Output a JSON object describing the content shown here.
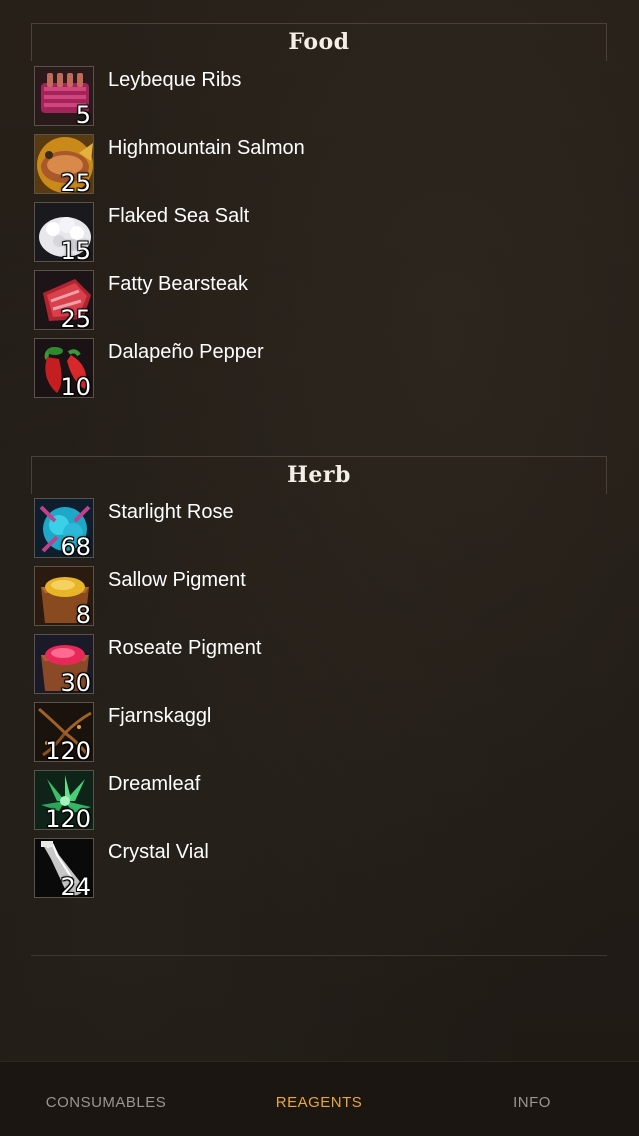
{
  "sections": [
    {
      "title": "Food",
      "items": [
        {
          "name": "Leybeque Ribs",
          "count": "5",
          "icon": "ribs-icon"
        },
        {
          "name": "Highmountain Salmon",
          "count": "25",
          "icon": "salmon-icon"
        },
        {
          "name": "Flaked Sea Salt",
          "count": "15",
          "icon": "salt-icon"
        },
        {
          "name": "Fatty Bearsteak",
          "count": "25",
          "icon": "bearsteak-icon"
        },
        {
          "name": "Dalapeño Pepper",
          "count": "10",
          "icon": "pepper-icon"
        }
      ]
    },
    {
      "title": "Herb",
      "items": [
        {
          "name": "Starlight Rose",
          "count": "68",
          "icon": "starlight-rose-icon"
        },
        {
          "name": "Sallow Pigment",
          "count": "8",
          "icon": "sallow-pigment-icon"
        },
        {
          "name": "Roseate Pigment",
          "count": "30",
          "icon": "roseate-pigment-icon"
        },
        {
          "name": "Fjarnskaggl",
          "count": "120",
          "icon": "fjarnskaggl-icon"
        },
        {
          "name": "Dreamleaf",
          "count": "120",
          "icon": "dreamleaf-icon"
        },
        {
          "name": "Crystal Vial",
          "count": "24",
          "icon": "crystal-vial-icon"
        }
      ]
    }
  ],
  "tabs": {
    "consumables": "CONSUMABLES",
    "reagents": "REAGENTS",
    "info": "INFO",
    "active": "reagents"
  },
  "colors": {
    "accent": "#e7a73a",
    "inactive_tab": "#9a958e",
    "background": "#221d17"
  }
}
